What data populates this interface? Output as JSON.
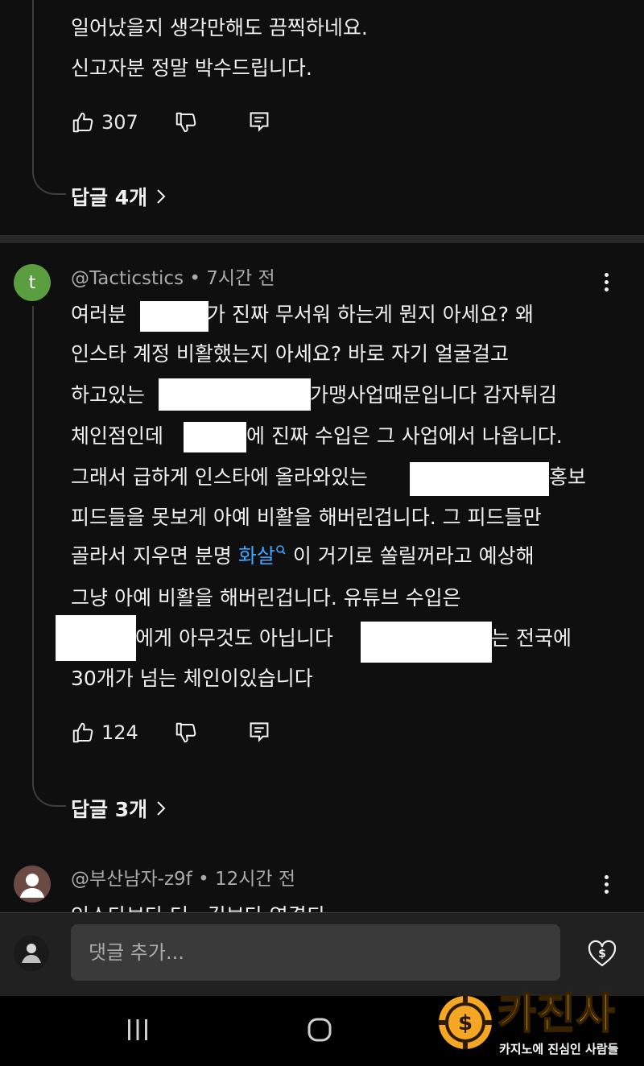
{
  "comment1": {
    "lines": [
      "일어났을지 생각만해도 끔찍하네요.",
      "신고자분 정말 박수드립니다."
    ],
    "likes": "307",
    "replies_label": "답글 4개"
  },
  "comment2": {
    "avatar_letter": "t",
    "avatar_color": "#5a9e3f",
    "username": "@Tacticstics",
    "separator": "•",
    "time": "7시간 전",
    "lines": {
      "l1a": "여러분",
      "l1b": "가 진짜 무서워 하는게 뭔지 아세요? 왜",
      "l2": "인스타 계정 비활했는지 아세요? 바로 자기 얼굴걸고",
      "l3a": "하고있는",
      "l3b": "가맹사업때문입니다 감자튀김",
      "l4a": "체인점인데",
      "l4b": "에 진짜 수입은 그 사업에서 나옵니다.",
      "l5a": "그래서 급하게 인스타에 올라와있는",
      "l5b": "홍보",
      "l6": "피드들을 못보게 아예 비활을 해버린겁니다. 그 피드들만",
      "l7a": "골라서 지우면 분명",
      "l7link": "화살",
      "l7b": "이 거기로 쏠릴꺼라고 예상해",
      "l8": "그냥 아예 비활을 해버린겁니다. 유튜브 수입은",
      "l9a": "에게 아무것도 아닙니다",
      "l9b": "는 전국에",
      "l10": "30개가 넘는 체인이있습니다"
    },
    "likes": "124",
    "replies_label": "답글 3개"
  },
  "comment3": {
    "username": "@부산남자-z9f",
    "separator": "•",
    "time": "12시간 전",
    "partial_text": "인스타보다 더 , 길보다 영결되 ㅡ ㅡ ㅡ"
  },
  "bottom": {
    "input_placeholder": "댓글 추가..."
  },
  "watermark": {
    "brand": "카진사",
    "tagline": "카지노에 진심인 사람들",
    "brand_color": "#f5a623"
  },
  "icons": [
    "thumb-up-icon",
    "thumb-down-icon",
    "reply-icon",
    "chevron-right-icon",
    "more-vert-icon",
    "search-link-icon",
    "super-thanks-icon",
    "nav-recents-icon",
    "nav-home-icon"
  ]
}
